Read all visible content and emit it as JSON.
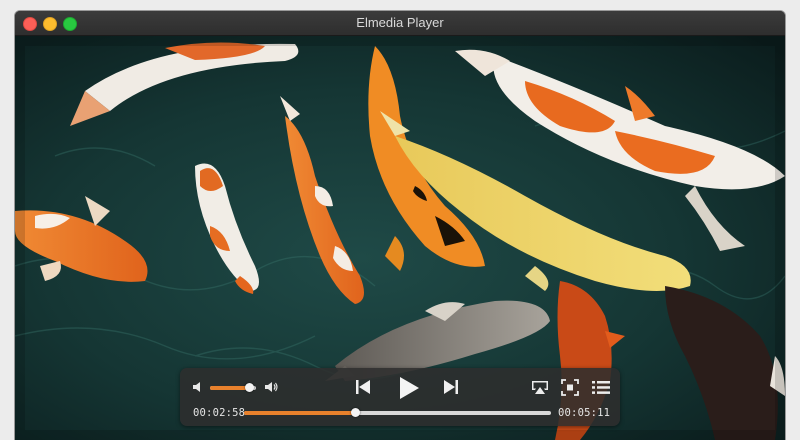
{
  "window": {
    "title": "Elmedia Player"
  },
  "player": {
    "elapsed": "00:02:58",
    "remaining": "00:05:11",
    "progress_fraction": 0.36,
    "volume_fraction": 0.85,
    "accent": "#e8812c"
  },
  "icons": {
    "volume_down": "volume-low-icon",
    "volume_up": "volume-high-icon",
    "previous": "skip-previous-icon",
    "play": "play-icon",
    "next": "skip-next-icon",
    "airplay": "airplay-icon",
    "fit": "fit-screen-icon",
    "playlist": "playlist-icon"
  }
}
